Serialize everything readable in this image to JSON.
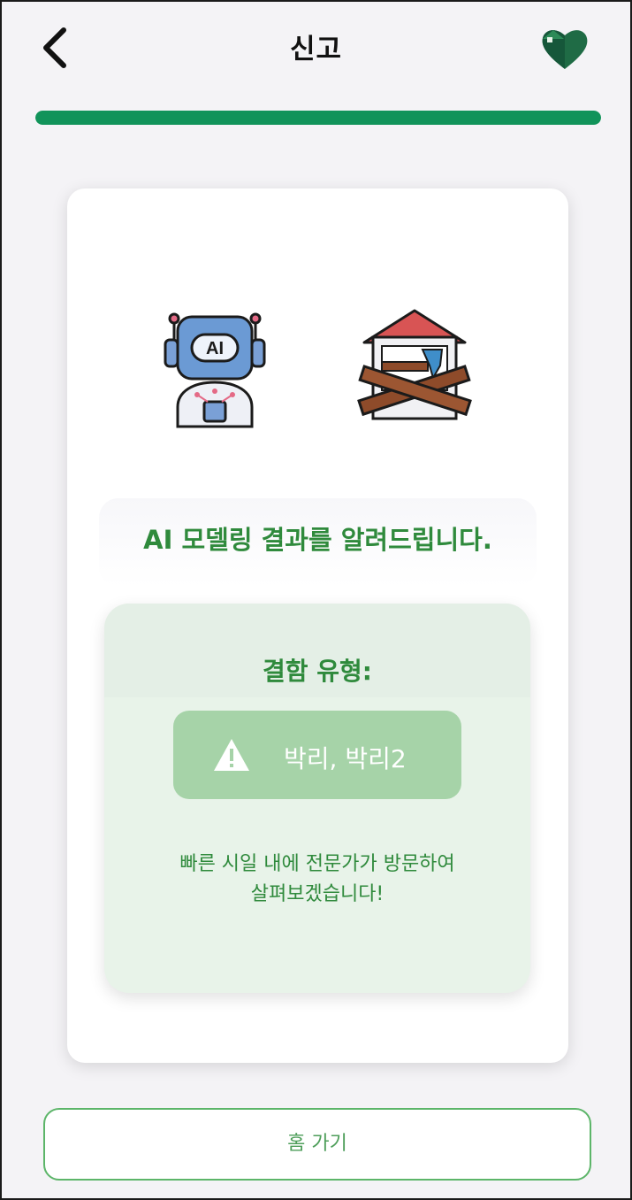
{
  "header": {
    "title": "신고",
    "back_icon": "chevron-left-icon",
    "logo_icon": "heart-house-logo"
  },
  "progress": {
    "fraction": 1.0,
    "color": "#11935a"
  },
  "illustrations": {
    "left": "ai-robot-icon",
    "right": "boarded-house-hammer-icon"
  },
  "headline": "AI 모델링 결과를 알려드립니다.",
  "result": {
    "defect_label": "결함 유형:",
    "defect_value": "박리, 박리2",
    "warning_icon": "warning-icon",
    "notice_line1": "빠른 시일 내에 전문가가 방문하여",
    "notice_line2": "살펴보겠습니다!"
  },
  "home_button": {
    "label": "홈 가기"
  },
  "colors": {
    "accent": "#2f8a3c",
    "pill": "#a6d3a8",
    "box": "#e8f3e9"
  }
}
